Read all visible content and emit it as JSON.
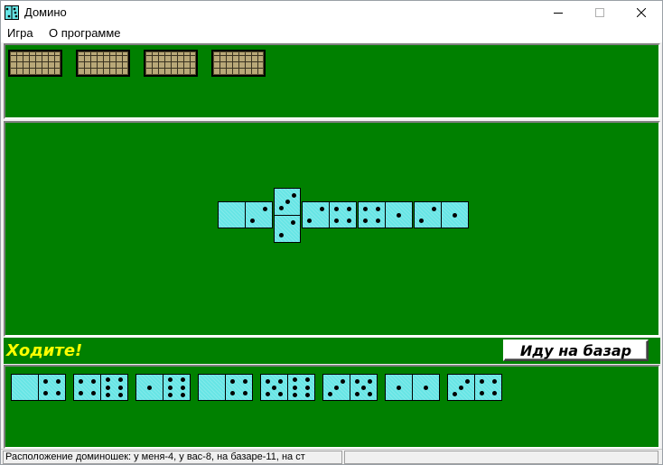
{
  "window": {
    "title": "Домино"
  },
  "menu": {
    "game": "Игра",
    "about": "О программе"
  },
  "opponent": {
    "tile_count": 4
  },
  "table": {
    "tiles": [
      {
        "a": 0,
        "b": 2,
        "orient": "h"
      },
      {
        "a": 3,
        "b": 2,
        "orient": "v"
      },
      {
        "a": 2,
        "b": 4,
        "orient": "h"
      },
      {
        "a": 4,
        "b": 1,
        "orient": "h"
      },
      {
        "a": 2,
        "b": 1,
        "orient": "h"
      }
    ]
  },
  "message": "Ходите!",
  "bazaar_button": "Иду на базар",
  "player": {
    "tiles": [
      {
        "a": 0,
        "b": 4
      },
      {
        "a": 4,
        "b": 6
      },
      {
        "a": 1,
        "b": 6
      },
      {
        "a": 0,
        "b": 4
      },
      {
        "a": 5,
        "b": 6
      },
      {
        "a": 3,
        "b": 5
      },
      {
        "a": 1,
        "b": 1
      },
      {
        "a": 3,
        "b": 4
      }
    ]
  },
  "status": {
    "text": "Расположение доминошек:  у меня-4, у вас-8, на базаре-11, на ст"
  }
}
